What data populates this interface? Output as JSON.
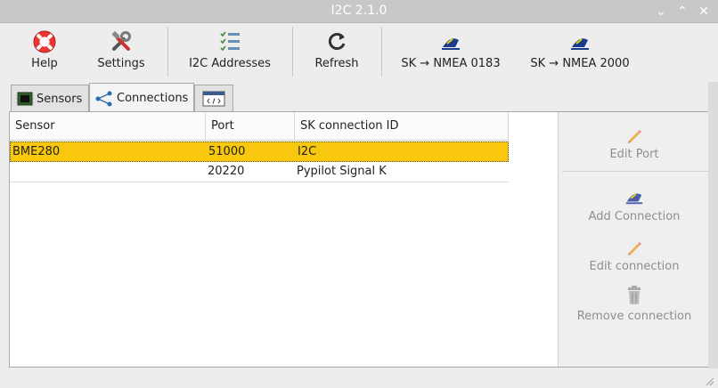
{
  "window": {
    "title": "I2C 2.1.0"
  },
  "toolbar": {
    "help": "Help",
    "settings": "Settings",
    "i2c_addresses": "I2C Addresses",
    "refresh": "Refresh",
    "sk_nmea0183": "SK → NMEA 0183",
    "sk_nmea2000": "SK → NMEA 2000"
  },
  "tabs": {
    "sensors": "Sensors",
    "connections": "Connections"
  },
  "table": {
    "headers": [
      "Sensor",
      "Port",
      "SK connection ID"
    ],
    "rows": [
      [
        "BME280",
        "51000",
        "I2C"
      ],
      [
        "",
        "20220",
        "Pypilot Signal K"
      ]
    ]
  },
  "side": {
    "edit_port": "Edit Port",
    "add_connection": "Add Connection",
    "edit_connection": "Edit connection",
    "remove_connection": "Remove connection"
  },
  "colors": {
    "selection": "#f9c80e",
    "disabled_text": "#8e8e8e"
  }
}
